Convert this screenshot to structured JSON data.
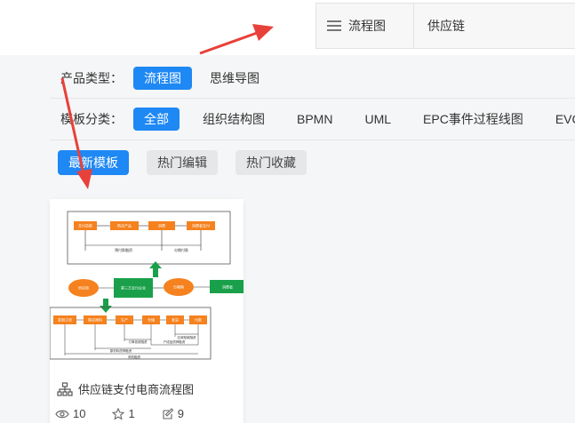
{
  "search": {
    "category": "流程图",
    "query": "供应链"
  },
  "product_type": {
    "label": "产品类型：",
    "options": [
      "流程图",
      "思维导图"
    ]
  },
  "template_category": {
    "label": "模板分类：",
    "options": [
      "全部",
      "组织结构图",
      "BPMN",
      "UML",
      "EPC事件过程线图",
      "EVC"
    ]
  },
  "tabs": [
    "最新模板",
    "热门编辑",
    "热门收藏"
  ],
  "card": {
    "title": "供应链支付电商流程图",
    "views": "10",
    "likes": "1",
    "edits": "9",
    "thumb_texts": {
      "top_boxes": [
        "支付货款",
        "购买产品",
        "消费",
        "消费者支付"
      ],
      "top_labels": [
        "预付款融资",
        "分期付款"
      ],
      "mid_nodes": [
        "供应商",
        "第三方支付企业",
        "分期购",
        "消费者"
      ],
      "bottom_boxes": [
        "签到订单",
        "购买原料",
        "生产",
        "仓储",
        "发货",
        "付款"
      ],
      "bottom_labels": [
        "订单信用融资",
        "产成品质押融资",
        "应收账款融资",
        "原材料质押融资",
        "采购融资"
      ]
    }
  },
  "colors": {
    "accent": "#1e88f5",
    "orange": "#f5821f",
    "green": "#1aa04a",
    "arrow": "#e8413a"
  }
}
